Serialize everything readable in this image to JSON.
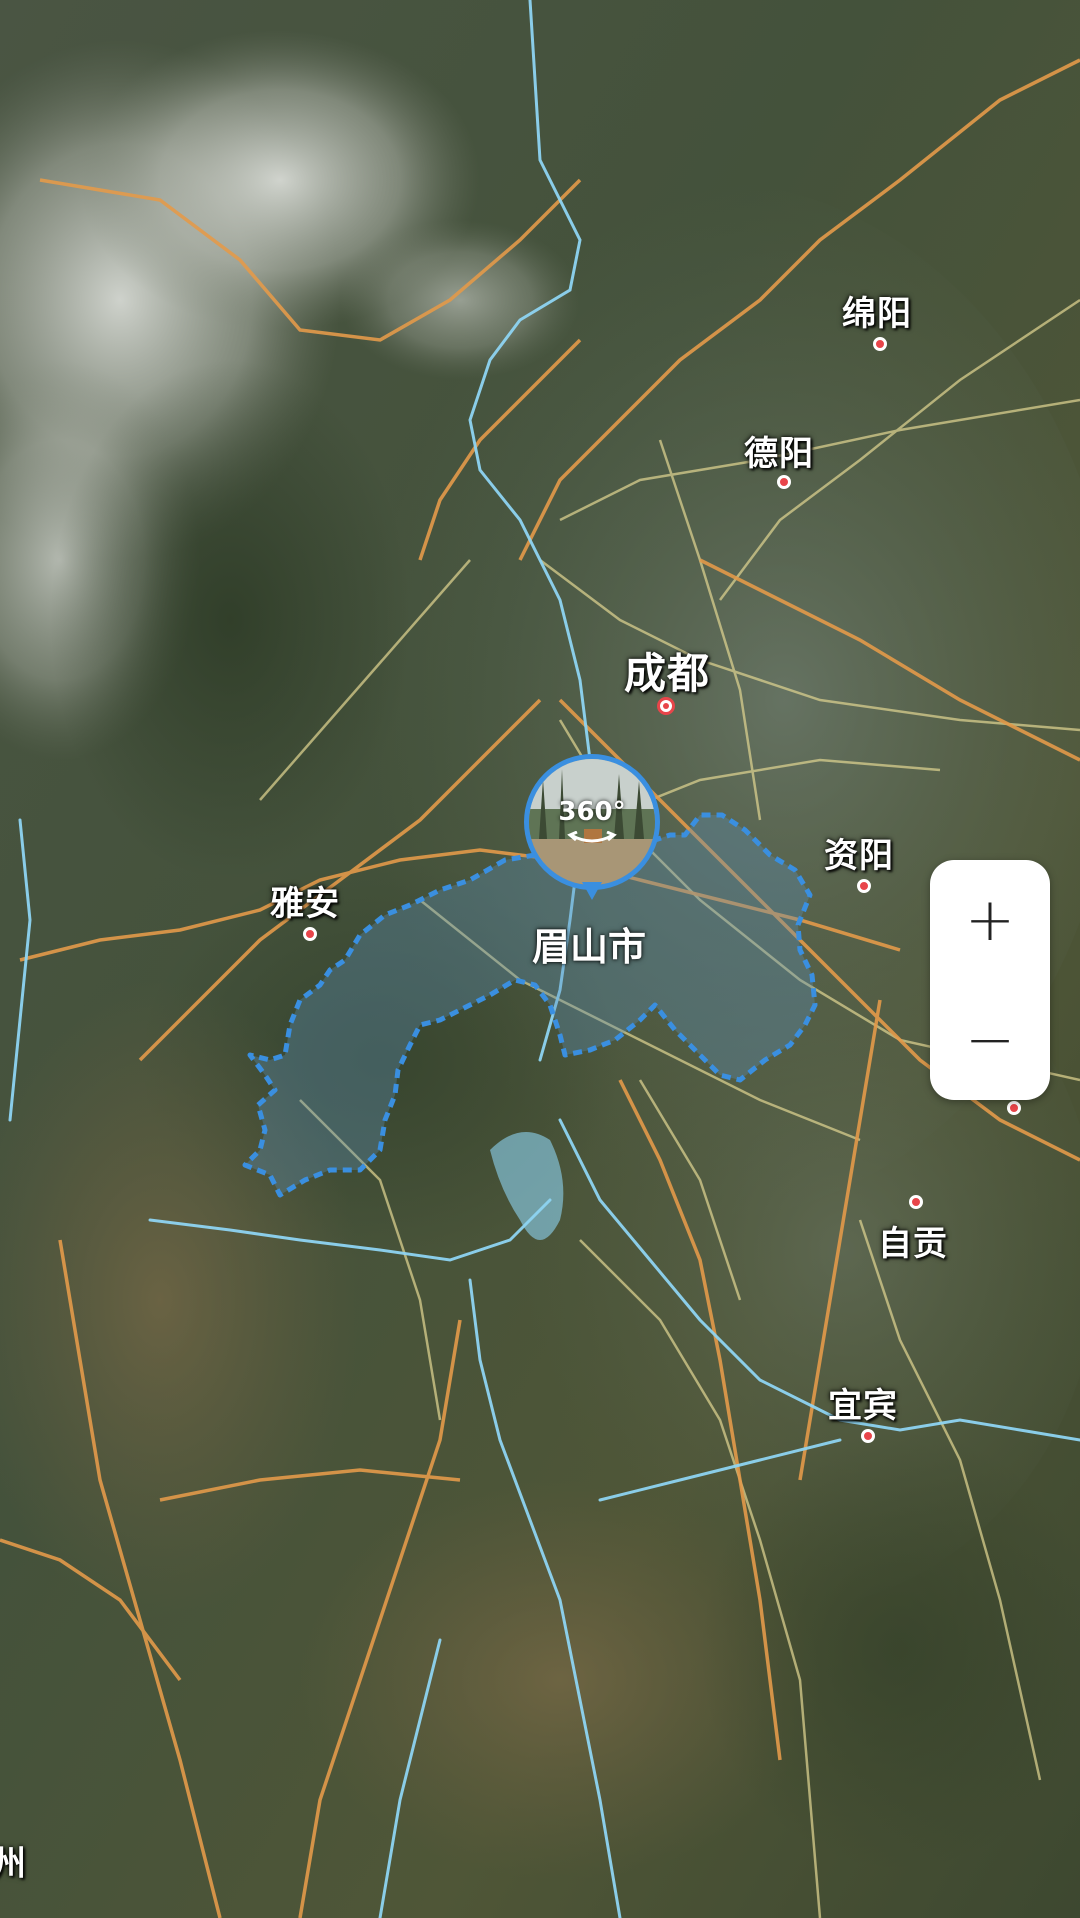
{
  "map": {
    "cities": [
      {
        "id": "mianyang",
        "name": "绵阳"
      },
      {
        "id": "deyang",
        "name": "德阳"
      },
      {
        "id": "chengdu",
        "name": "成都"
      },
      {
        "id": "ziyang",
        "name": "资阳"
      },
      {
        "id": "yaan",
        "name": "雅安"
      },
      {
        "id": "zigong",
        "name": "自贡"
      },
      {
        "id": "yibin",
        "name": "宜宾"
      }
    ],
    "highlighted_region": "眉山市",
    "edge_label_left": "州",
    "pano_badge": "360°",
    "colors": {
      "region_border": "#3a8fe0",
      "river": "#8ed4f2",
      "highway": "#e39a4a",
      "road": "#d9cf8e",
      "city_dot": "#e8454a"
    }
  },
  "controls": {
    "zoom_in_label": "+",
    "zoom_out_label": "−"
  }
}
